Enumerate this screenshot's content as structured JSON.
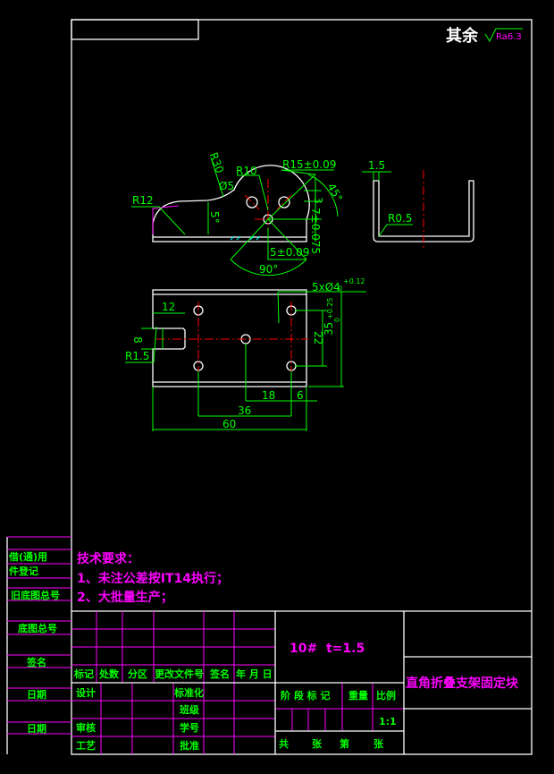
{
  "roughness": {
    "label": "其余",
    "value": "Ra6.3"
  },
  "dims": {
    "r12": "R12",
    "r30": "R30",
    "d5": "Ø5",
    "r10": "R10",
    "r15": "R15±0.09",
    "three": "3",
    "deg45": "45°",
    "five_deg": "5°",
    "seven": "7±0.075",
    "five_tol": "5±0.09",
    "deg90": "90°",
    "t15": "1.5",
    "r05": "R0.5",
    "holes": "5xØ4",
    "holes_tol": "+0.12",
    "holes_tol0": "0",
    "d12": "12",
    "d8": "8",
    "r15s": "R1.5",
    "d22": "22",
    "d35": "35",
    "d35_tol": "+0.25",
    "d35_tol0": "0",
    "d18": "18",
    "d6": "6",
    "d36": "36",
    "d60": "60"
  },
  "tech": {
    "title": "技术要求：",
    "items": [
      "1、未注公差按IT14执行；",
      "2、大批量生产；"
    ]
  },
  "left_strip": [
    "借(通)用",
    "件登记",
    "旧底图总号",
    "底图总号",
    "签名",
    "日期",
    "日期"
  ],
  "title_block": {
    "header_cols": [
      "标记",
      "处数",
      "分区",
      "更改文件号",
      "签名",
      "年 月 日"
    ],
    "rows": [
      "设计",
      "标准化",
      "班级",
      "审核",
      "学号",
      "工艺",
      "批准"
    ],
    "material": "10#  t=1.5",
    "stage_cols": [
      "阶 段 标 记",
      "重量",
      "比例"
    ],
    "scale": "1:1",
    "sheets": [
      "共",
      "张",
      "第",
      "张"
    ],
    "part_name": "直角折叠支架固定块"
  }
}
